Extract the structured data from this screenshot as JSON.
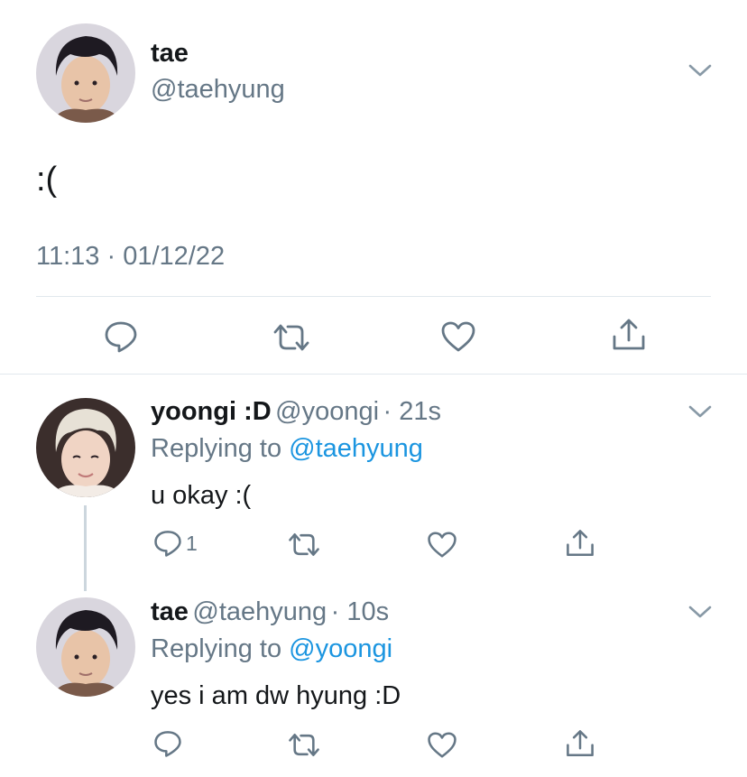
{
  "main_tweet": {
    "display_name": "tae",
    "handle": "@taehyung",
    "text": ":(",
    "timestamp": "11:13 · 01/12/22",
    "avatar_icon": "avatar-photo-icon",
    "menu_icon": "chevron-down-icon"
  },
  "actions": {
    "reply_icon": "reply-icon",
    "retweet_icon": "retweet-icon",
    "like_icon": "heart-icon",
    "share_icon": "share-icon"
  },
  "replies": [
    {
      "display_name": "yoongi :D",
      "handle": "@yoongi",
      "age": "· 21s",
      "replying_prefix": "Replying to",
      "replying_to": "@taehyung",
      "text": "u okay :(",
      "reply_count": "1"
    },
    {
      "display_name": "tae",
      "handle": "@taehyung",
      "age": "· 10s",
      "replying_prefix": "Replying to",
      "replying_to": "@yoongi",
      "text": "yes i am dw hyung :D",
      "reply_count": ""
    }
  ],
  "colors": {
    "text": "#14171a",
    "secondary": "#657786",
    "link": "#1b95e0",
    "divider": "#e1e8ed",
    "icon": "#657786"
  }
}
